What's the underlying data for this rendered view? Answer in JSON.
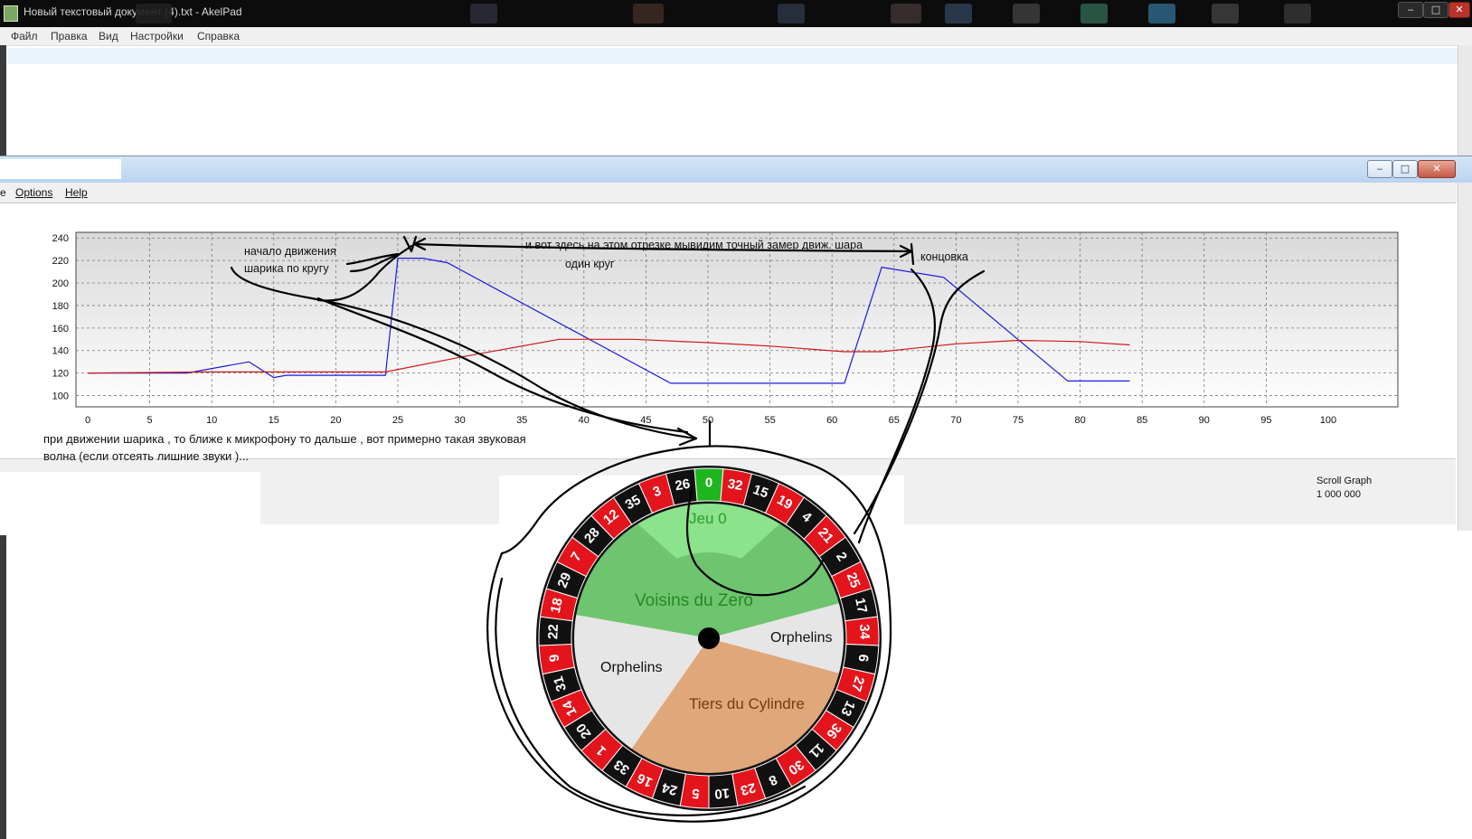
{
  "akelpad": {
    "title": "Новый текстовый документ (4).txt - AkelPad",
    "menu": [
      "Файл",
      "Правка",
      "Вид",
      "Настройки",
      "Справка"
    ],
    "controls": {
      "minimize": "‒",
      "maximize": "□",
      "close": "✕"
    }
  },
  "graph_window": {
    "menu": [
      "e",
      "Options",
      "Help"
    ],
    "controls": {
      "minimize": "‒",
      "maximize": "□",
      "close": "✕"
    },
    "caption_line1": "при движении шарика , то ближе к микрофону то дальше , вот примерно такая звуковая",
    "caption_line2": "волна (если отсеять лишние звуки )...",
    "status_label": "Scroll Graph",
    "status_value": "1 000 000"
  },
  "annotations": {
    "start_line1": "начало движения",
    "start_line2": "шарика по кругу",
    "segment_note": "и вот здесь на этом отрезке мывидим точный замер движ. шара",
    "one_lap": "один круг",
    "ending": "концовка"
  },
  "chart_data": {
    "type": "line",
    "title": "",
    "xlabel": "",
    "ylabel": "",
    "xlim": [
      0,
      100
    ],
    "ylim": [
      90,
      245
    ],
    "x_ticks": [
      0,
      5,
      10,
      15,
      20,
      25,
      30,
      35,
      40,
      45,
      50,
      55,
      60,
      65,
      70,
      75,
      80,
      85,
      90,
      95,
      100
    ],
    "y_ticks": [
      100,
      120,
      140,
      160,
      180,
      200,
      220,
      240
    ],
    "grid": true,
    "colors": {
      "blue": "#1a1ae0",
      "red": "#d01818"
    },
    "series": [
      {
        "color": "blue",
        "points": [
          [
            0,
            120
          ],
          [
            8,
            120
          ],
          [
            13,
            130
          ],
          [
            15,
            116
          ],
          [
            16,
            118
          ],
          [
            24,
            118
          ],
          [
            25,
            222
          ],
          [
            27,
            222
          ],
          [
            29,
            218
          ],
          [
            47,
            111
          ],
          [
            61,
            111
          ],
          [
            64,
            214
          ],
          [
            69,
            205
          ],
          [
            79,
            113
          ],
          [
            84,
            113
          ]
        ]
      },
      {
        "color": "red",
        "points": [
          [
            0,
            120
          ],
          [
            10,
            121
          ],
          [
            20,
            121
          ],
          [
            24,
            121
          ],
          [
            30,
            134
          ],
          [
            38,
            150
          ],
          [
            44,
            150
          ],
          [
            50,
            147
          ],
          [
            55,
            144
          ],
          [
            61,
            139
          ],
          [
            64,
            139
          ],
          [
            70,
            146
          ],
          [
            75,
            149
          ],
          [
            80,
            148
          ],
          [
            84,
            145
          ]
        ]
      }
    ]
  },
  "roulette": {
    "numbers": [
      "0",
      "32",
      "15",
      "19",
      "4",
      "21",
      "2",
      "25",
      "17",
      "34",
      "6",
      "27",
      "13",
      "36",
      "11",
      "30",
      "8",
      "23",
      "10",
      "5",
      "24",
      "16",
      "33",
      "1",
      "20",
      "14",
      "31",
      "9",
      "22",
      "18",
      "29",
      "7",
      "28",
      "12",
      "35",
      "3",
      "26"
    ],
    "sectors": [
      "Jeu 0",
      "Voisins du Zero",
      "Orphelins",
      "Orphelins",
      "Tiers du Cylindre"
    ],
    "colors": {
      "red": "#e4141c",
      "black": "#111111",
      "green": "#1fb51f",
      "jeu0": "#8be38b",
      "voisins": "#6fc46f",
      "orphelins": "#e6e6e6",
      "tiers": "#dfa77a"
    }
  }
}
